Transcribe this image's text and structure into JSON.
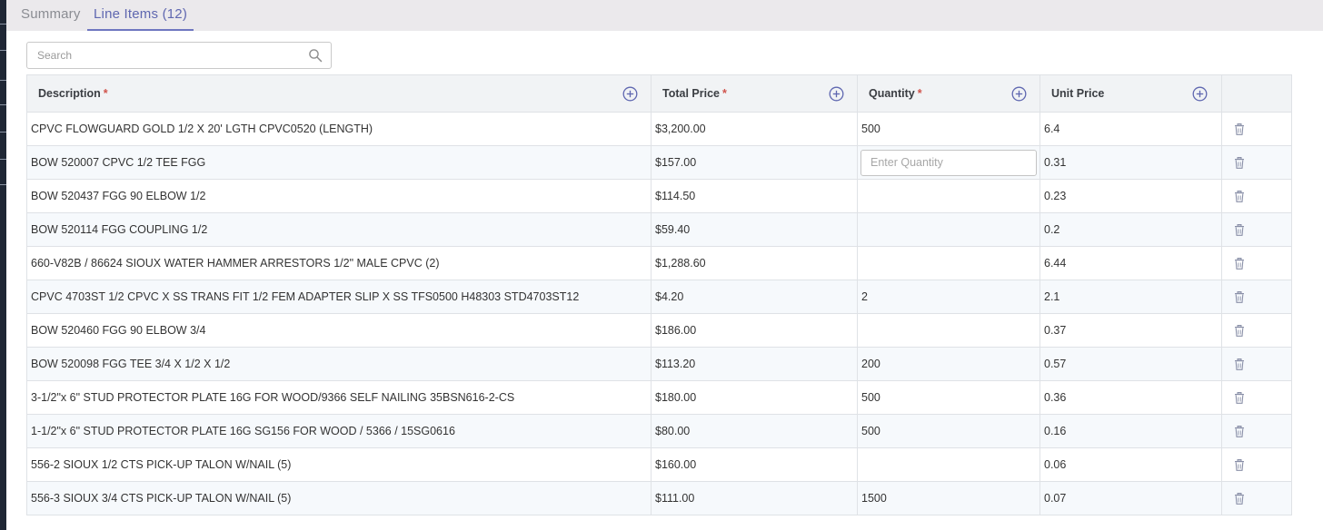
{
  "tabs": {
    "summary": "Summary",
    "line_items": "Line Items (12)"
  },
  "search": {
    "placeholder": "Search",
    "value": ""
  },
  "columns": {
    "description": "Description",
    "total_price": "Total Price",
    "quantity": "Quantity",
    "unit_price": "Unit Price",
    "required_mark": "*"
  },
  "quantity_placeholder": "Enter Quantity",
  "rows": [
    {
      "description": "CPVC FLOWGUARD GOLD 1/2 X 20' LGTH CPVC0520 (LENGTH)",
      "total_price": "$3,200.00",
      "quantity": "500",
      "unit_price": "6.4"
    },
    {
      "description": "BOW 520007 CPVC 1/2 TEE FGG",
      "total_price": "$157.00",
      "quantity": "",
      "unit_price": "0.31"
    },
    {
      "description": "BOW 520437 FGG 90 ELBOW 1/2",
      "total_price": "$114.50",
      "quantity": "",
      "unit_price": "0.23"
    },
    {
      "description": "BOW 520114 FGG COUPLING 1/2",
      "total_price": "$59.40",
      "quantity": "",
      "unit_price": "0.2"
    },
    {
      "description": "660-V82B / 86624 SIOUX WATER HAMMER ARRESTORS 1/2\" MALE CPVC (2)",
      "total_price": "$1,288.60",
      "quantity": "",
      "unit_price": "6.44"
    },
    {
      "description": "CPVC 4703ST 1/2 CPVC X SS TRANS FIT 1/2 FEM ADAPTER SLIP X SS TFS0500 H48303 STD4703ST12",
      "total_price": "$4.20",
      "quantity": "2",
      "unit_price": "2.1"
    },
    {
      "description": "BOW 520460 FGG 90 ELBOW 3/4",
      "total_price": "$186.00",
      "quantity": "",
      "unit_price": "0.37"
    },
    {
      "description": "BOW 520098 FGG TEE 3/4 X 1/2 X 1/2",
      "total_price": "$113.20",
      "quantity": "200",
      "unit_price": "0.57"
    },
    {
      "description": "3-1/2\"x 6\" STUD PROTECTOR PLATE 16G FOR WOOD/9366 SELF NAILING 35BSN616-2-CS",
      "total_price": "$180.00",
      "quantity": "500",
      "unit_price": "0.36"
    },
    {
      "description": "1-1/2\"x 6\" STUD PROTECTOR PLATE 16G SG156 FOR WOOD / 5366 / 15SG0616",
      "total_price": "$80.00",
      "quantity": "500",
      "unit_price": "0.16"
    },
    {
      "description": "556-2 SIOUX 1/2 CTS PICK-UP TALON W/NAIL (5)",
      "total_price": "$160.00",
      "quantity": "",
      "unit_price": "0.06"
    },
    {
      "description": "556-3 SIOUX 3/4 CTS PICK-UP TALON W/NAIL (5)",
      "total_price": "$111.00",
      "quantity": "1500",
      "unit_price": "0.07"
    }
  ],
  "colors": {
    "accent": "#5f67b0",
    "required": "#d0534b",
    "header_bg": "#f1f3f5",
    "tabbar_bg": "#ebe9ec"
  },
  "icons": {
    "search": "search-icon",
    "add_column": "plus-circle-icon",
    "delete": "trash-icon"
  }
}
